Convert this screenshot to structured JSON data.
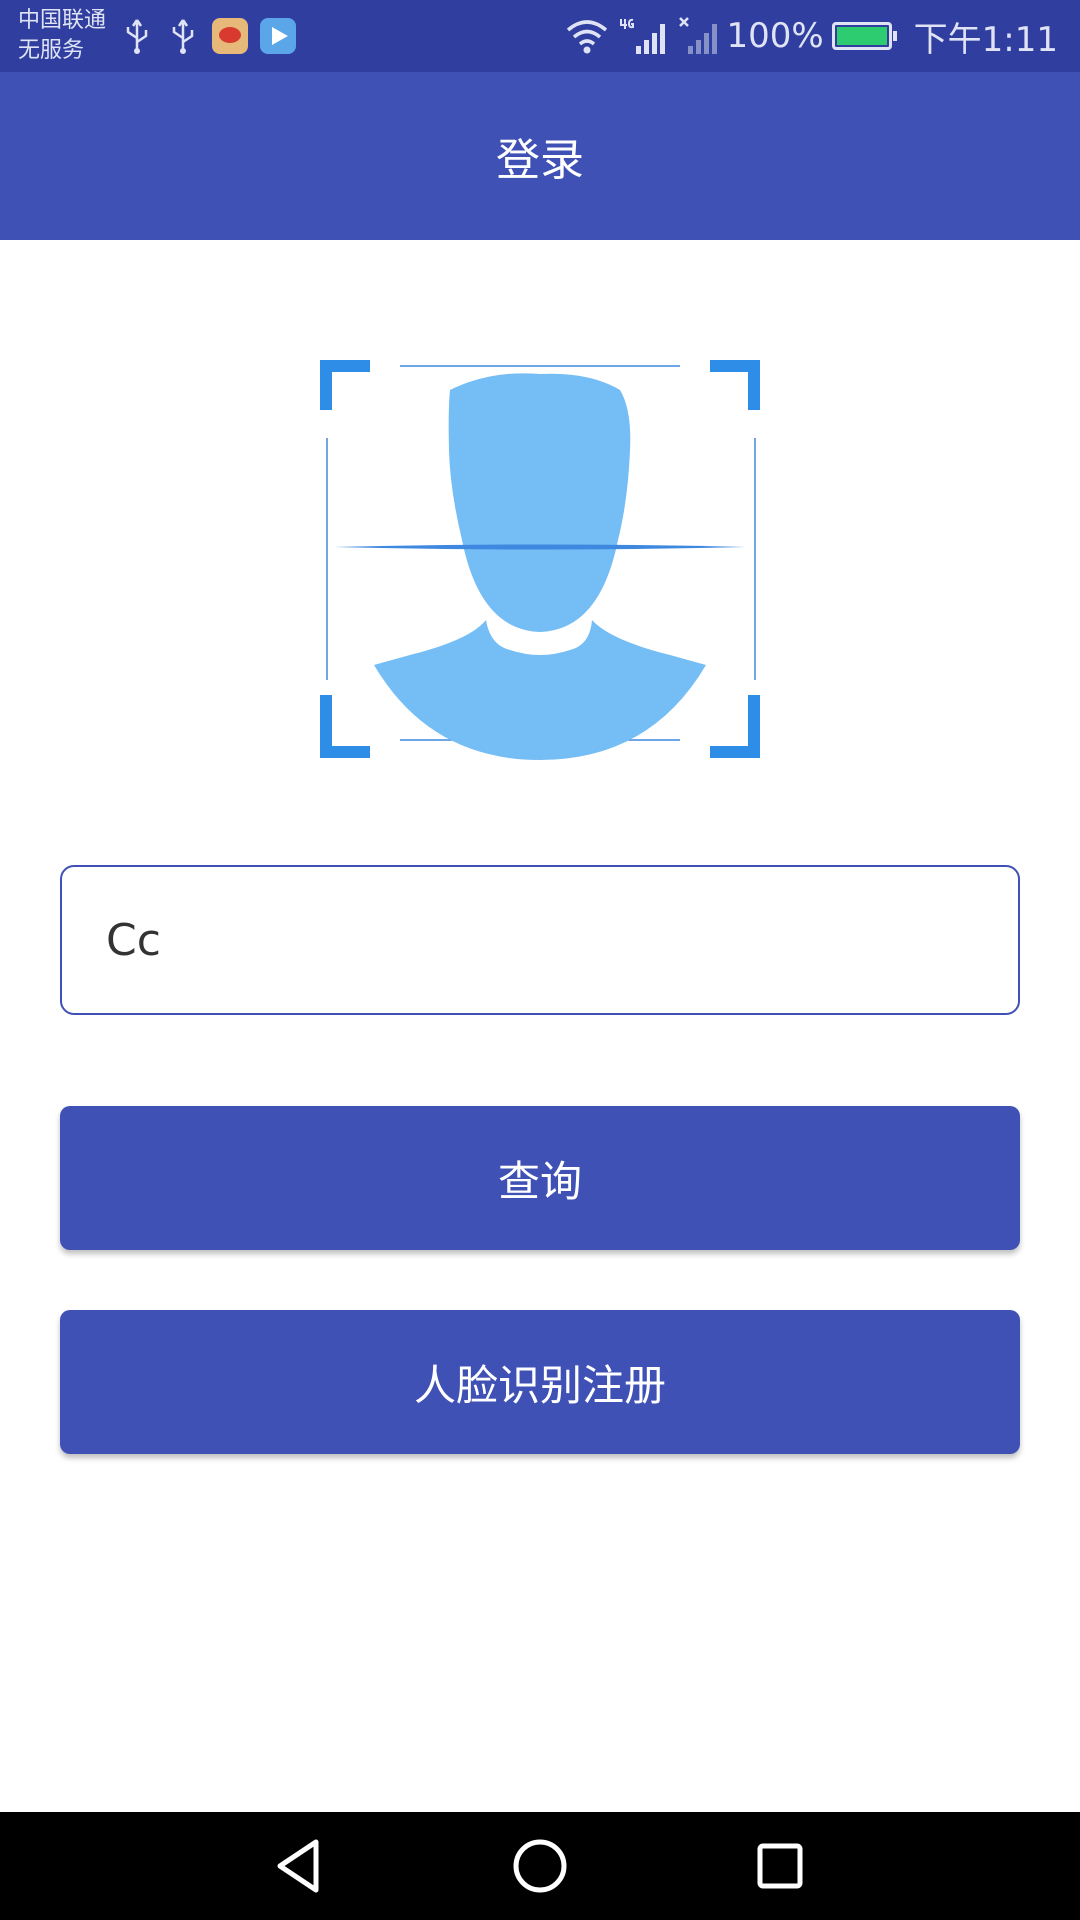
{
  "status_bar": {
    "carrier_line1": "中国联通",
    "carrier_line2": "无服务",
    "battery_percent": "100%",
    "time": "下午1:11",
    "notification_icons": [
      "usb-icon",
      "usb-icon",
      "weibo-icon",
      "video-icon"
    ],
    "system_icons": [
      "wifi-icon",
      "signal-4g-icon",
      "signal-no-service-icon",
      "battery-charging-icon"
    ]
  },
  "app_bar": {
    "title": "登录"
  },
  "face_illustration": {
    "icon": "face-scan-icon",
    "colors": {
      "frame": "#2E8DE6",
      "silhouette": "#74BDF5",
      "scan_line": "#3F88E0"
    }
  },
  "form": {
    "name_input_value": "Cc"
  },
  "buttons": {
    "query_label": "查询",
    "register_label": "人脸识别注册"
  },
  "nav_bar": {
    "items": [
      "back-icon",
      "home-icon",
      "recent-apps-icon"
    ]
  },
  "colors": {
    "status_bar": "#303F9F",
    "primary": "#3F51B5",
    "nav_bar": "#000000"
  }
}
